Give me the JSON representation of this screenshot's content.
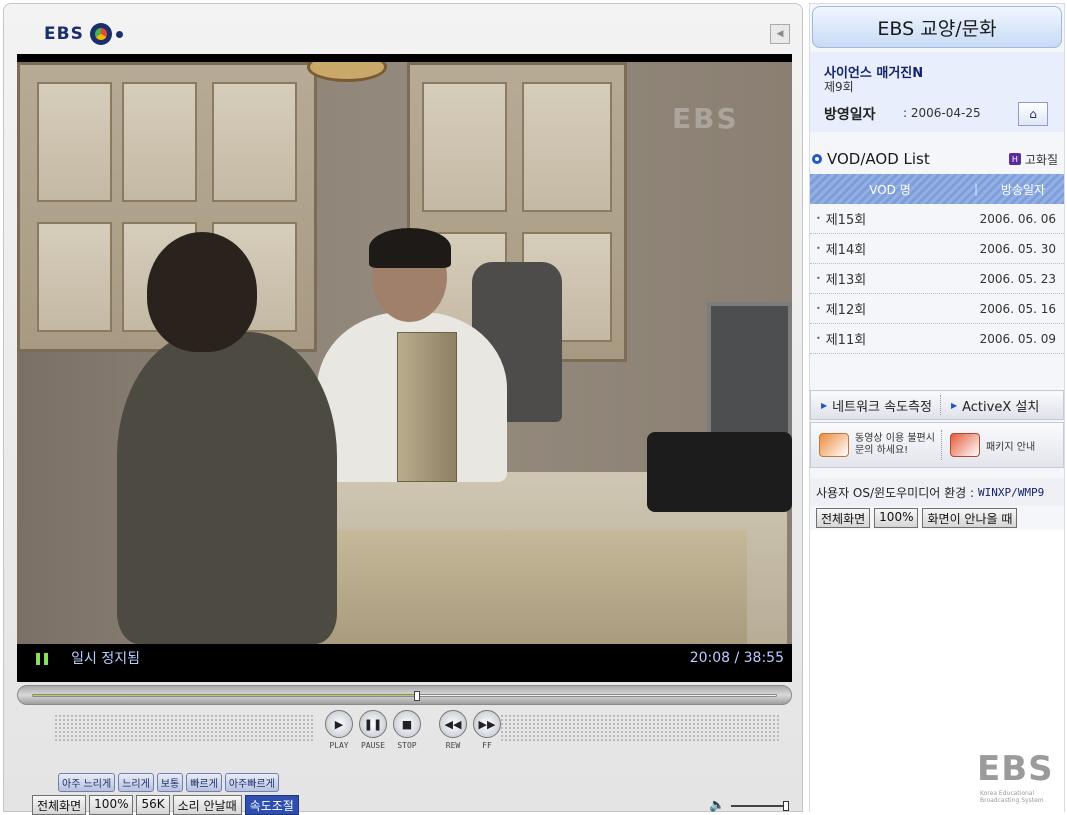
{
  "player": {
    "logo_text": "EBS",
    "status": "일시 정지됨",
    "time": "20:08 / 38:55",
    "watermark": "EBS",
    "progress_fraction": 0.517,
    "controls": {
      "play": "PLAY",
      "pause": "PAUSE",
      "stop": "STOP",
      "rew": "REW",
      "ff": "FF"
    },
    "speed_options": [
      "아주 느리게",
      "느리게",
      "보통",
      "빠르게",
      "아주빠르게"
    ],
    "bottom_buttons": [
      "전체화면",
      "100%",
      "56K",
      "소리 안날때",
      "속도조절"
    ],
    "active_bottom_button": "속도조절",
    "volume_fraction": 1.0
  },
  "side": {
    "title": "EBS 교양/문화",
    "program": {
      "title": "사이언스 매거진N",
      "episode": "제9회",
      "air_label": "방영일자",
      "air_date": ": 2006-04-25"
    },
    "list": {
      "title": "VOD/AOD List",
      "hq_label": "고화질",
      "col_name": "VOD 명",
      "col_date": "방송일자",
      "rows": [
        {
          "ep": "제15회",
          "date": "2006. 06. 06"
        },
        {
          "ep": "제14회",
          "date": "2006. 05. 30"
        },
        {
          "ep": "제13회",
          "date": "2006. 05. 23"
        },
        {
          "ep": "제12회",
          "date": "2006. 05. 16"
        },
        {
          "ep": "제11회",
          "date": "2006. 05. 09"
        }
      ]
    },
    "net_speed": "네트워크 속도측정",
    "activex": "ActiveX 설치",
    "help_line1": "동영상 이용 불편시",
    "help_line2": "문의 하세요!",
    "package": "패키지 안내",
    "env_label": "사용자 OS/윈도우미디어 환경 :",
    "env_value": "WINXP/WMP9",
    "buttons": [
      "전체화면",
      "100%",
      "화면이 안나올 때"
    ],
    "logo": "EBS",
    "logo_sub": "Korea Educational Broadcasting System"
  },
  "colors": {
    "accent": "#2357c6",
    "status_text": "#b8ccff",
    "progress": "#b8cf59",
    "active_button": "#2e4fae"
  }
}
